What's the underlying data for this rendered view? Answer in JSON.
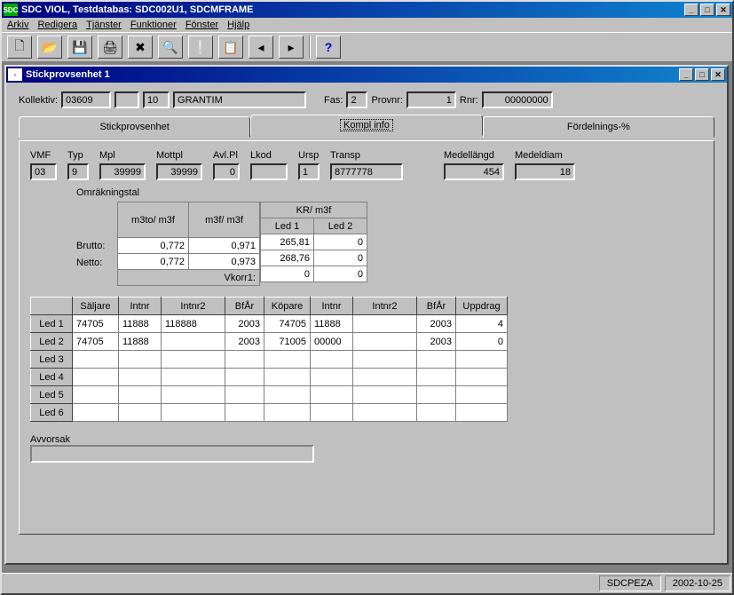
{
  "app": {
    "icon_text": "SDC",
    "title": "SDC VIOL, Testdatabas: SDC002U1, SDCMFRAME"
  },
  "menu": {
    "arkiv": "Arkiv",
    "redigera": "Redigera",
    "tjanster": "Tjänster",
    "funktioner": "Funktioner",
    "fonster": "Fönster",
    "hjalp": "Hjälp"
  },
  "toolbar_icons": {
    "new": "🗋",
    "open": "📂",
    "save": "💾",
    "print": "🖨",
    "delete": "✖",
    "find": "🔍",
    "alert": "❕",
    "copy": "📋",
    "prev": "◂",
    "next": "▸",
    "help": "?"
  },
  "child": {
    "title": "Stickprovsenhet 1"
  },
  "header": {
    "kollektiv_label": "Kollektiv:",
    "kollektiv": "03609",
    "blank1": "",
    "seq": "10",
    "name": "GRANTIM",
    "fas_label": "Fas:",
    "fas": "2",
    "provnr_label": "Provnr:",
    "provnr": "1",
    "rnr_label": "Rnr:",
    "rnr": "00000000"
  },
  "tabs": {
    "t1": "Stickprovsenhet",
    "t2": "Kompl info",
    "t3": "Fördelnings-%"
  },
  "fields": {
    "vmf": {
      "label": "VMF",
      "value": "03"
    },
    "typ": {
      "label": "Typ",
      "value": "9"
    },
    "mpl": {
      "label": "Mpl",
      "value": "39999"
    },
    "mottpl": {
      "label": "Mottpl",
      "value": "39999"
    },
    "avlpl": {
      "label": "Avl.Pl",
      "value": "0"
    },
    "lkod": {
      "label": "Lkod",
      "value": ""
    },
    "ursp": {
      "label": "Ursp",
      "value": "1"
    },
    "transp": {
      "label": "Transp",
      "value": "8777778"
    },
    "medellangd": {
      "label": "Medellängd",
      "value": "454"
    },
    "medeldiam": {
      "label": "Medeldiam",
      "value": "18"
    }
  },
  "om": {
    "title": "Omräkningstal",
    "col1": "m3to/ m3f",
    "col2": "m3f/ m3f",
    "kr_header": "KR/ m3f",
    "led1": "Led 1",
    "led2": "Led 2",
    "brutto_label": "Brutto:",
    "netto_label": "Netto:",
    "vkorr_label": "Vkorr1:",
    "brutto": {
      "c1": "0,772",
      "c2": "0,971",
      "l1": "265,81",
      "l2": "0"
    },
    "netto": {
      "c1": "0,772",
      "c2": "0,973",
      "l1": "268,76",
      "l2": "0"
    },
    "vkorr": {
      "l1": "0",
      "l2": "0"
    }
  },
  "grid": {
    "headers": {
      "saljare": "Säljare",
      "intnr": "Intnr",
      "intnr2": "Intnr2",
      "bfar": "BfÅr",
      "kopare": "Köpare",
      "intnr_b": "Intnr",
      "intnr2_b": "Intnr2",
      "bfar_b": "BfÅr",
      "uppdrag": "Uppdrag"
    },
    "rows": [
      {
        "label": "Led 1",
        "saljare": "74705",
        "intnr": "11888",
        "intnr2": "118888",
        "bfar": "2003",
        "kopare": "74705",
        "intnr_b": "11888",
        "intnr2_b": "",
        "bfar_b": "2003",
        "uppdrag": "4"
      },
      {
        "label": "Led 2",
        "saljare": "74705",
        "intnr": "11888",
        "intnr2": "",
        "bfar": "2003",
        "kopare": "71005",
        "intnr_b": "00000",
        "intnr2_b": "",
        "bfar_b": "2003",
        "uppdrag": "0"
      },
      {
        "label": "Led 3",
        "saljare": "",
        "intnr": "",
        "intnr2": "",
        "bfar": "",
        "kopare": "",
        "intnr_b": "",
        "intnr2_b": "",
        "bfar_b": "",
        "uppdrag": ""
      },
      {
        "label": "Led 4",
        "saljare": "",
        "intnr": "",
        "intnr2": "",
        "bfar": "",
        "kopare": "",
        "intnr_b": "",
        "intnr2_b": "",
        "bfar_b": "",
        "uppdrag": ""
      },
      {
        "label": "Led 5",
        "saljare": "",
        "intnr": "",
        "intnr2": "",
        "bfar": "",
        "kopare": "",
        "intnr_b": "",
        "intnr2_b": "",
        "bfar_b": "",
        "uppdrag": ""
      },
      {
        "label": "Led 6",
        "saljare": "",
        "intnr": "",
        "intnr2": "",
        "bfar": "",
        "kopare": "",
        "intnr_b": "",
        "intnr2_b": "",
        "bfar_b": "",
        "uppdrag": ""
      }
    ]
  },
  "avvorsak": {
    "label": "Avvorsak",
    "value": ""
  },
  "status": {
    "user": "SDCPEZA",
    "date": "2002-10-25"
  }
}
